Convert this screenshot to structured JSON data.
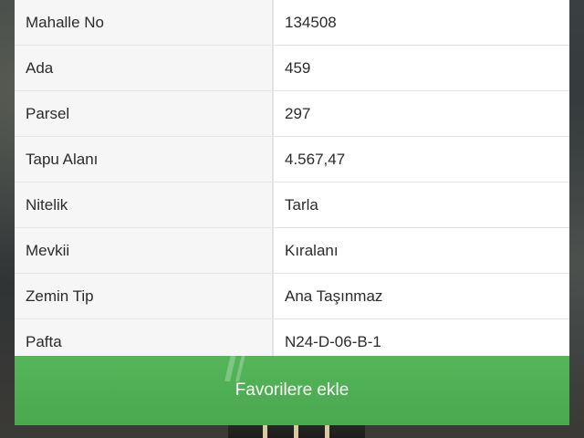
{
  "table": {
    "rows": [
      {
        "key": "Mahalle No",
        "value": "134508"
      },
      {
        "key": "Ada",
        "value": "459"
      },
      {
        "key": "Parsel",
        "value": "297"
      },
      {
        "key": "Tapu Alanı",
        "value": "4.567,47"
      },
      {
        "key": "Nitelik",
        "value": "Tarla"
      },
      {
        "key": "Mevkii",
        "value": "Kıralanı"
      },
      {
        "key": "Zemin Tip",
        "value": "Ana Taşınmaz"
      },
      {
        "key": "Pafta",
        "value": "N24-D-06-B-1"
      }
    ]
  },
  "actions": {
    "favorite_label": "Favorilere ekle"
  },
  "colors": {
    "accent_green": "#4caf50",
    "row_divider": "#e3e3e3"
  }
}
